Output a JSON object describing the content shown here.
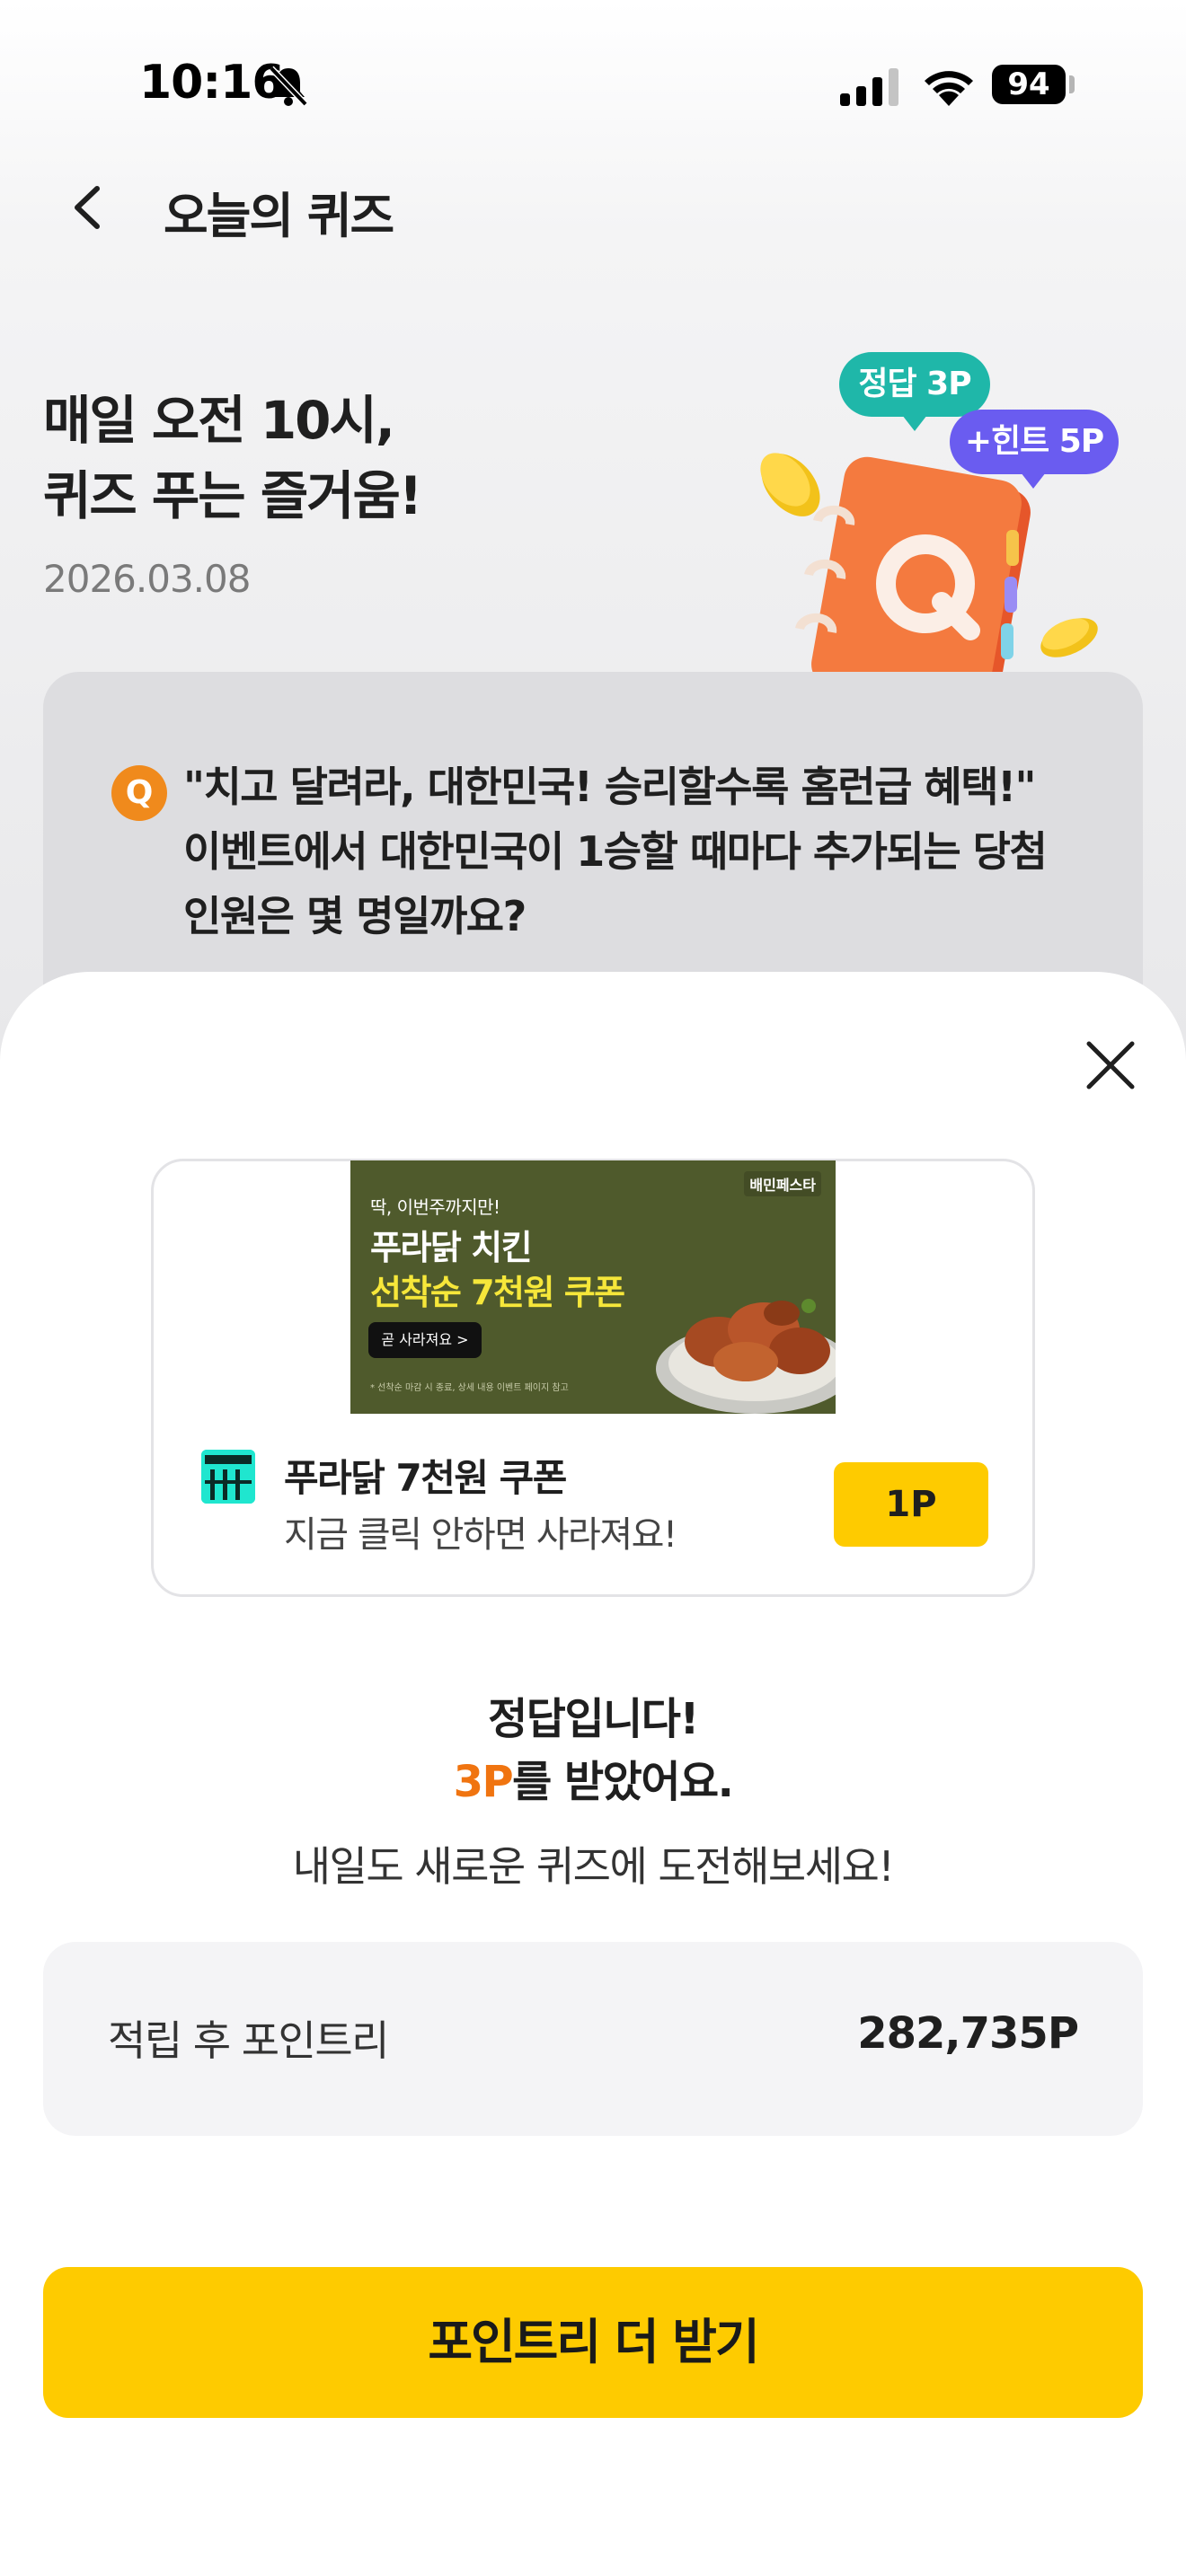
{
  "status_bar": {
    "time": "10:16",
    "battery": "94"
  },
  "nav": {
    "title": "오늘의 퀴즈"
  },
  "hero": {
    "title": "매일 오전 10시,\n퀴즈 푸는 즐거움!",
    "date": "2026.03.08",
    "badge_answer": "정답 3P",
    "badge_hint": "+힌트 5P"
  },
  "question": {
    "badge": "Q",
    "text": "\"치고 달려라, 대한민국! 승리할수록 홈런급 혜택!\"\n이벤트에서 대한민국이 1승할 때마다 추가되는 당첨\n인원은 몇 명일까요?"
  },
  "ad": {
    "banner": {
      "subtitle": "딱, 이번주까지만!",
      "line1": "푸라닭 치킨",
      "line2": "선착순 7천원 쿠폰",
      "cta": "곧 사라져요 >",
      "note": "* 선착순 마감 시 종료, 상세 내용 이벤트 페이지 참고",
      "logo": "배민페스타"
    },
    "title": "푸라닭 7천원 쿠폰",
    "description": "지금 클릭 안하면 사라져요!",
    "reward": "1P"
  },
  "result": {
    "line1": "정답입니다!",
    "points_highlight": "3P",
    "line2_rest": "를 받았어요.",
    "line3": "내일도 새로운 퀴즈에 도전해보세요!"
  },
  "points": {
    "label": "적립 후 포인트리",
    "value": "282,735P"
  },
  "cta": {
    "label": "포인트리 더 받기"
  },
  "colors": {
    "accent_yellow": "#fecb00",
    "accent_orange": "#f07410",
    "answer_badge": "#1fb7a9",
    "hint_badge": "#6a5cf0"
  }
}
